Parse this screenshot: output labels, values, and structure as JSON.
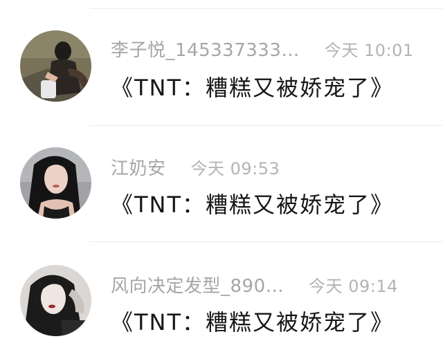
{
  "messages": [
    {
      "author": "李子悦_145337333…",
      "time": "今天 10:01",
      "text": "《TNT：糟糕又被娇宠了》",
      "avatar_icon": "avatar-photo-outdoor-masked-girl",
      "avatar_colors": {
        "bg": "#6f6a52",
        "accent": "#2b2622"
      }
    },
    {
      "author": "江奶安",
      "time": "今天 09:53",
      "text": "《TNT：糟糕又被娇宠了》",
      "avatar_icon": "avatar-photo-long-hair-girl",
      "avatar_colors": {
        "bg": "#9c9ea2",
        "accent": "#141414"
      }
    },
    {
      "author": "风向决定发型_890…",
      "time": "今天 09:14",
      "text": "《TNT：糟糕又被娇宠了》",
      "avatar_icon": "avatar-photo-dark-hair-girl",
      "avatar_colors": {
        "bg": "#d9d6d3",
        "accent": "#1b1b1b"
      }
    }
  ]
}
